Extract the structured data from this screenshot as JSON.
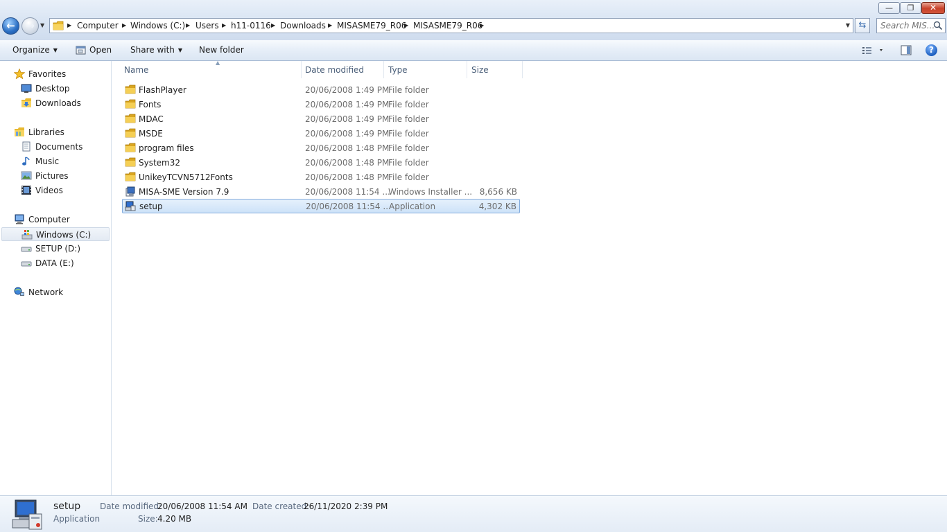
{
  "window": {
    "minimize_glyph": "—",
    "maximize_glyph": "❐",
    "close_glyph": "✕"
  },
  "address": {
    "crumbs": [
      "Computer",
      "Windows (C:)",
      "Users",
      "h11-0116",
      "Downloads",
      "MISASME79_R06",
      "MISASME79_R06"
    ],
    "search_placeholder": "Search MIS..."
  },
  "toolbar": {
    "organize": "Organize",
    "open": "Open",
    "share_with": "Share with",
    "new_folder": "New folder",
    "help": "?"
  },
  "nav": {
    "favorites": "Favorites",
    "desktop": "Desktop",
    "downloads": "Downloads",
    "libraries": "Libraries",
    "documents": "Documents",
    "music": "Music",
    "pictures": "Pictures",
    "videos": "Videos",
    "computer": "Computer",
    "windows_c": "Windows (C:)",
    "setup_d": "SETUP (D:)",
    "data_e": "DATA (E:)",
    "network": "Network"
  },
  "columns": {
    "name": "Name",
    "date": "Date modified",
    "type": "Type",
    "size": "Size"
  },
  "files": [
    {
      "name": "FlashPlayer",
      "date": "20/06/2008 1:49 PM",
      "type": "File folder",
      "size": "",
      "icon": "folder-icon"
    },
    {
      "name": "Fonts",
      "date": "20/06/2008 1:49 PM",
      "type": "File folder",
      "size": "",
      "icon": "folder-icon"
    },
    {
      "name": "MDAC",
      "date": "20/06/2008 1:49 PM",
      "type": "File folder",
      "size": "",
      "icon": "folder-icon"
    },
    {
      "name": "MSDE",
      "date": "20/06/2008 1:49 PM",
      "type": "File folder",
      "size": "",
      "icon": "folder-icon"
    },
    {
      "name": "program files",
      "date": "20/06/2008 1:48 PM",
      "type": "File folder",
      "size": "",
      "icon": "folder-icon"
    },
    {
      "name": "System32",
      "date": "20/06/2008 1:48 PM",
      "type": "File folder",
      "size": "",
      "icon": "folder-icon"
    },
    {
      "name": "UnikeyTCVN5712Fonts",
      "date": "20/06/2008 1:48 PM",
      "type": "File folder",
      "size": "",
      "icon": "folder-icon"
    },
    {
      "name": "MISA-SME Version 7.9",
      "date": "20/06/2008 11:54 ...",
      "type": "Windows Installer ...",
      "size": "8,656 KB",
      "icon": "installer-icon"
    },
    {
      "name": "setup",
      "date": "20/06/2008 11:54 ...",
      "type": "Application",
      "size": "4,302 KB",
      "icon": "setup-app-icon",
      "selected": true
    }
  ],
  "details": {
    "name": "setup",
    "type": "Application",
    "date_modified_label": "Date modified:",
    "date_modified": "20/06/2008 11:54 AM",
    "date_created_label": "Date created:",
    "date_created": "26/11/2020 2:39 PM",
    "size_label": "Size:",
    "size": "4.20 MB"
  },
  "colors": {
    "selection_bg": "#cde2f8",
    "selection_border": "#84acdd",
    "folder_yellow": "#f2c94c",
    "header_text": "#4c607a"
  }
}
